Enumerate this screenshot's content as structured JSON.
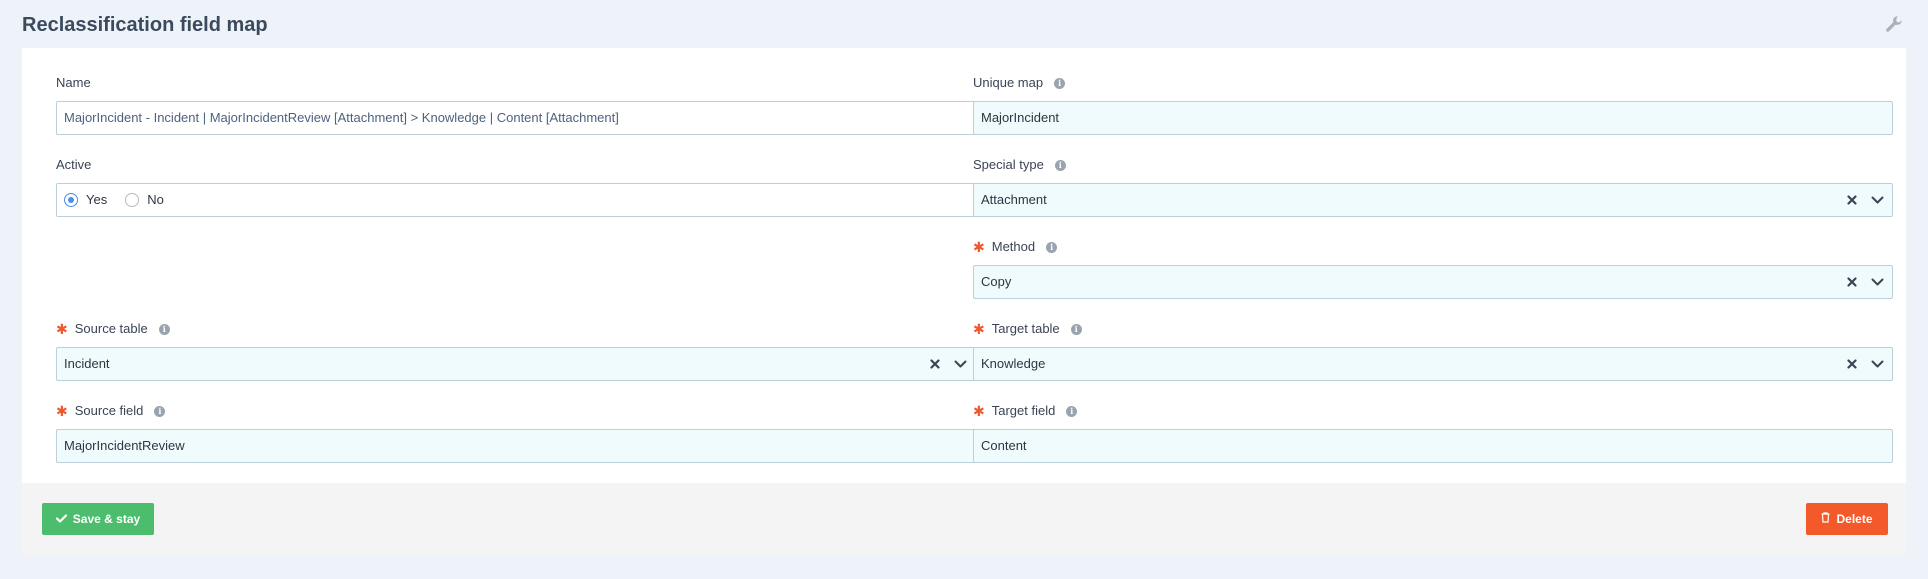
{
  "page": {
    "title": "Reclassification field map"
  },
  "form": {
    "name": {
      "label": "Name",
      "value": "MajorIncident - Incident | MajorIncidentReview [Attachment] > Knowledge | Content [Attachment]"
    },
    "unique_map": {
      "label": "Unique map",
      "value": "MajorIncident"
    },
    "active": {
      "label": "Active",
      "options": [
        "Yes",
        "No"
      ],
      "selected": "Yes"
    },
    "special_type": {
      "label": "Special type",
      "value": "Attachment"
    },
    "method": {
      "label": "Method",
      "value": "Copy",
      "required": true
    },
    "source_table": {
      "label": "Source table",
      "value": "Incident",
      "required": true
    },
    "target_table": {
      "label": "Target table",
      "value": "Knowledge",
      "required": true
    },
    "source_field": {
      "label": "Source field",
      "value": "MajorIncidentReview",
      "required": true
    },
    "target_field": {
      "label": "Target field",
      "value": "Content",
      "required": true
    }
  },
  "footer": {
    "save_label": "Save & stay",
    "delete_label": "Delete"
  },
  "colors": {
    "save": "#4cbd6c",
    "delete": "#f4592a",
    "required": "#f0572d",
    "radio_selected": "#4a8ee8"
  },
  "icons": [
    "wrench-icon",
    "info-icon",
    "clear-icon",
    "chevron-down-icon",
    "check-icon",
    "trash-icon"
  ]
}
